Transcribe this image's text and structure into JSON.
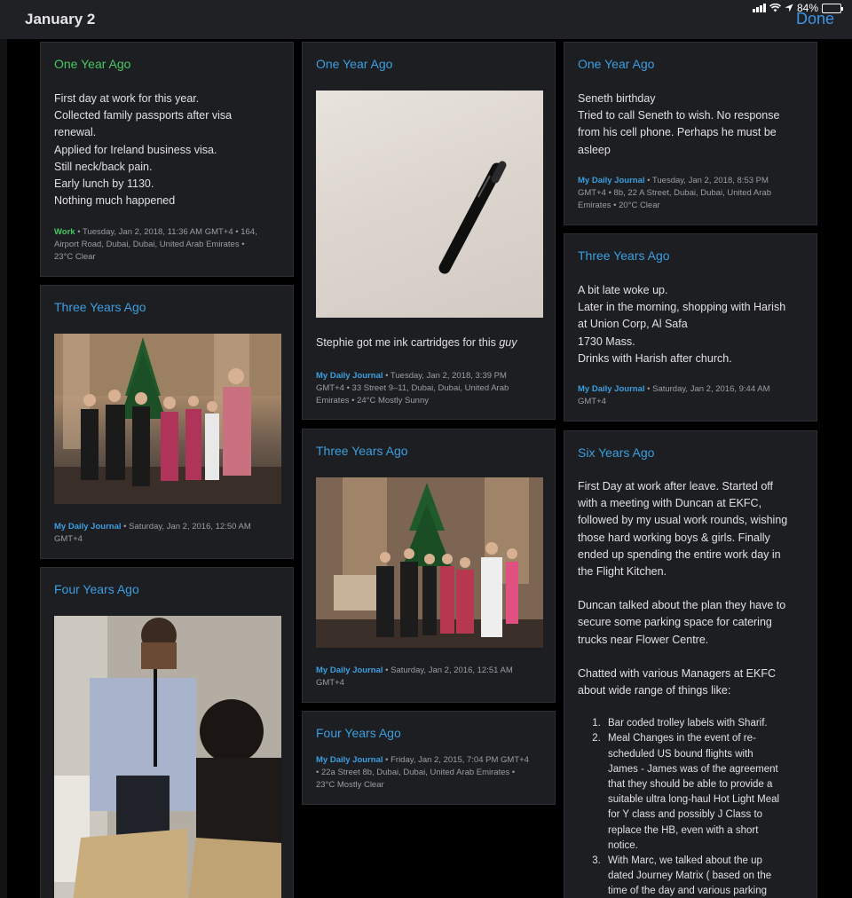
{
  "header": {
    "title": "January 2",
    "done_label": "Done"
  },
  "status_bar": {
    "battery_text": "84%"
  },
  "cards": {
    "c1": {
      "heading": "One Year Ago",
      "lines": [
        "First day at work for this year.",
        "Collected family passports after visa",
        "renewal.",
        "Applied for Ireland business visa.",
        "Still neck/back pain.",
        "Early lunch by 1130.",
        "Nothing much happened"
      ],
      "journal": "Work",
      "meta_lines": [
        " • Tuesday, Jan 2, 2018, 11:36 AM GMT+4 • 164,",
        "Airport Road, Dubai, Dubai, United Arab Emirates •",
        "23°C Clear"
      ]
    },
    "c2": {
      "heading": "Three Years Ago",
      "journal": "My Daily Journal",
      "meta_lines": [
        " • Saturday, Jan 2, 2016, 12:50 AM",
        "GMT+4"
      ]
    },
    "c3": {
      "heading": "Four Years Ago"
    },
    "c4": {
      "heading": "One Year Ago",
      "caption_text": "Stephie got me ink cartridges for this ",
      "caption_em": "guy",
      "journal": "My Daily Journal",
      "meta_lines": [
        " • Tuesday, Jan 2, 2018, 3:39 PM",
        "GMT+4 • 33 Street 9–11, Dubai, Dubai, United Arab",
        "Emirates • 24°C Mostly Sunny"
      ]
    },
    "c5": {
      "heading": "Three Years Ago",
      "journal": "My Daily Journal",
      "meta_lines": [
        " • Saturday, Jan 2, 2016, 12:51 AM",
        "GMT+4"
      ]
    },
    "c6": {
      "heading": "Four Years Ago",
      "journal": "My Daily Journal",
      "meta_lines": [
        " • Friday, Jan 2, 2015, 7:04 PM GMT+4",
        "• 22a Street 8b, Dubai, Dubai, United Arab Emirates •",
        "23°C Mostly Clear"
      ]
    },
    "c7": {
      "heading": "One Year Ago",
      "lines": [
        "Seneth birthday",
        "Tried to call Seneth to wish. No response",
        "from his cell phone. Perhaps he must be",
        "asleep"
      ],
      "journal": "My Daily Journal",
      "meta_lines": [
        " • Tuesday, Jan 2, 2018, 8:53 PM",
        "GMT+4 • 8b, 22 A Street, Dubai, Dubai, United Arab",
        "Emirates • 20°C Clear"
      ]
    },
    "c8": {
      "heading": "Three Years Ago",
      "lines": [
        "A bit late woke up.",
        "Later in the morning, shopping with Harish",
        "at Union Corp, Al Safa",
        "1730 Mass.",
        "Drinks with Harish after church."
      ],
      "journal": "My Daily Journal",
      "meta_lines": [
        " • Saturday, Jan 2, 2016, 9:44 AM",
        "GMT+4"
      ]
    },
    "c9": {
      "heading": "Six Years Ago",
      "para1": [
        "First Day at work after leave. Started off",
        "with a meeting with Duncan at EKFC,",
        "followed by my usual work rounds, wishing",
        "those hard working boys & girls. Finally",
        "ended up spending the entire work day in",
        "the Flight Kitchen."
      ],
      "para2": [
        "Duncan talked about the plan they have to",
        "secure some parking space for catering",
        "trucks near Flower Centre."
      ],
      "para3": [
        "Chatted with various Managers at EKFC",
        "about wide range of things like:"
      ],
      "points": [
        [
          "Bar coded trolley labels with Sharif."
        ],
        [
          "Meal Changes in the event of re-",
          "scheduled US bound flights with",
          "James - James was of the agreement",
          "that they should be able to provide a",
          "suitable ultra long-haul Hot Light Meal",
          "for Y class and possibly J Class to",
          "replace the HB, even with a short",
          "notice."
        ],
        [
          "With Marc, we talked about the up",
          "dated Journey Matrix ( based on the",
          "time of the day and various parking"
        ]
      ]
    }
  }
}
